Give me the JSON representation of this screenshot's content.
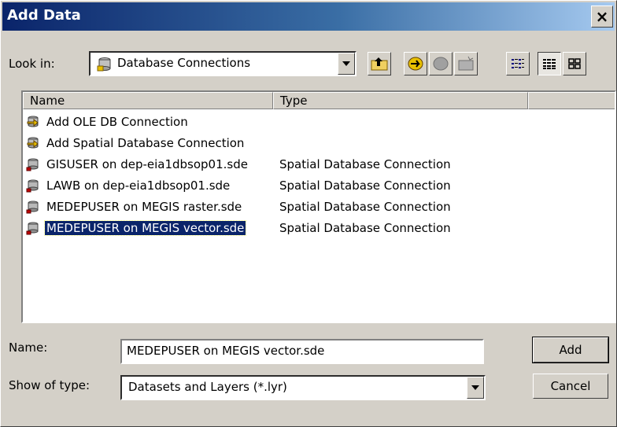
{
  "window": {
    "title": "Add Data",
    "close_label": "×"
  },
  "lookin": {
    "label": "Look in:",
    "value": "Database Connections"
  },
  "columns": {
    "name": "Name",
    "type": "Type"
  },
  "items": [
    {
      "name": "Add OLE DB Connection",
      "type": "",
      "icon": "add-connection-icon"
    },
    {
      "name": "Add Spatial Database Connection",
      "type": "",
      "icon": "add-connection-icon"
    },
    {
      "name": "GISUSER on dep-eia1dbsop01.sde",
      "type": "Spatial Database Connection",
      "icon": "database-connection-icon"
    },
    {
      "name": "LAWB on dep-eia1dbsop01.sde",
      "type": "Spatial Database Connection",
      "icon": "database-connection-icon"
    },
    {
      "name": "MEDEPUSER on MEGIS raster.sde",
      "type": "Spatial Database Connection",
      "icon": "database-connection-icon"
    },
    {
      "name": "MEDEPUSER on MEGIS vector.sde",
      "type": "Spatial Database Connection",
      "icon": "database-connection-icon",
      "selected": true
    }
  ],
  "name_field": {
    "label": "Name:",
    "value": "MEDEPUSER on MEGIS vector.sde"
  },
  "type_field": {
    "label": "Show of type:",
    "value": "Datasets and Layers (*.lyr)"
  },
  "buttons": {
    "add": "Add",
    "cancel": "Cancel"
  },
  "colors": {
    "title_start": "#0a246a",
    "title_end": "#a6caf0",
    "selection": "#0a246a",
    "face": "#d4d0c8"
  }
}
